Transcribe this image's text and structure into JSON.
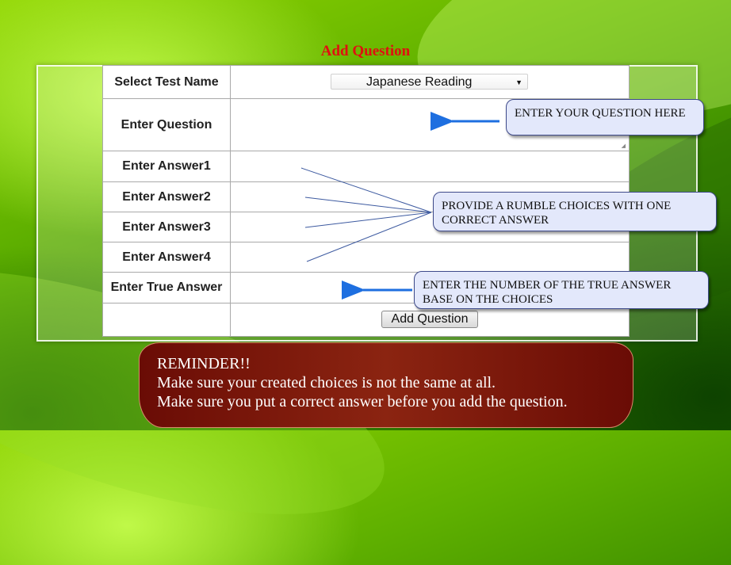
{
  "page": {
    "title": "Add Question"
  },
  "form": {
    "rows": [
      {
        "label": "Select Test Name"
      },
      {
        "label": "Enter Question"
      },
      {
        "label": "Enter Answer1"
      },
      {
        "label": "Enter Answer2"
      },
      {
        "label": "Enter Answer3"
      },
      {
        "label": "Enter Answer4"
      },
      {
        "label": "Enter True Answer"
      }
    ],
    "test_select": {
      "value": "Japanese Reading"
    },
    "question": {
      "value": ""
    },
    "answer1": {
      "value": ""
    },
    "answer2": {
      "value": ""
    },
    "answer3": {
      "value": ""
    },
    "answer4": {
      "value": ""
    },
    "true_answer": {
      "value": ""
    },
    "submit_label": "Add Question"
  },
  "callouts": {
    "question": "ENTER YOUR QUESTION HERE",
    "answers": "PROVIDE A RUMBLE CHOICES WITH ONE CORRECT ANSWER",
    "true_answer": "ENTER THE NUMBER OF THE TRUE ANSWER BASE ON THE CHOICES"
  },
  "reminder": {
    "heading": "REMINDER!!",
    "lines": [
      "Make sure your created choices is not the same at all.",
      "Make sure you put a correct answer before you add the question."
    ]
  },
  "colors": {
    "title": "#e01010",
    "reminder_bg": "#7a1608",
    "callout_bg": "#e3e8fb",
    "arrow": "#1e6fe0"
  }
}
